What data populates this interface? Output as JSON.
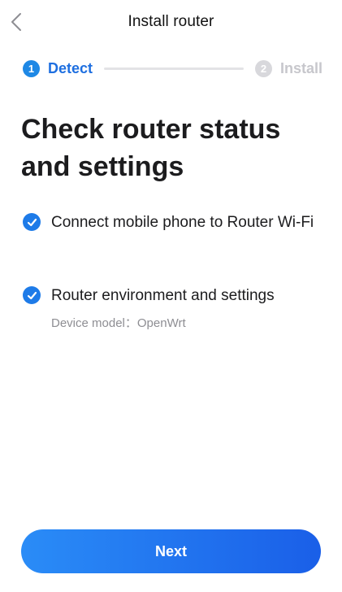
{
  "header": {
    "title": "Install router",
    "back_icon": "chevron-left-icon"
  },
  "stepper": {
    "steps": [
      {
        "number": "1",
        "label": "Detect",
        "state": "active"
      },
      {
        "number": "2",
        "label": "Install",
        "state": "inactive"
      }
    ],
    "active_color": "#1e88e5",
    "inactive_color": "#d8d8dc"
  },
  "main": {
    "title": "Check router status and settings",
    "items": [
      {
        "label": "Connect mobile phone to Router Wi-Fi",
        "checked": true,
        "icon": "check-circle-icon"
      },
      {
        "label": "Router environment and settings",
        "checked": true,
        "icon": "check-circle-icon",
        "detail": "Device model：OpenWrt"
      }
    ]
  },
  "footer": {
    "next_label": "Next",
    "button_colors": [
      "#2a8cf7",
      "#1a5fe8"
    ]
  }
}
